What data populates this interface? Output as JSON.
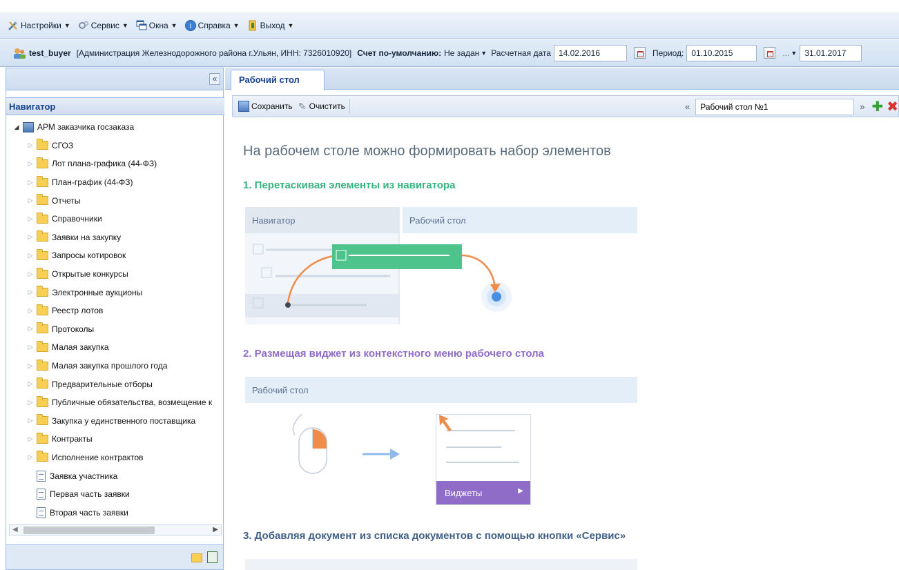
{
  "menu": {
    "items": [
      {
        "label": "Настройки",
        "icon": "settings-icon"
      },
      {
        "label": "Сервис",
        "icon": "service-icon"
      },
      {
        "label": "Окна",
        "icon": "windows-icon"
      },
      {
        "label": "Справка",
        "icon": "help-icon"
      },
      {
        "label": "Выход",
        "icon": "exit-icon"
      }
    ]
  },
  "infobar": {
    "user": "test_buyer",
    "org": "[Администрация Железнодорожного района г.Ульян, ИНН: 7326010920]",
    "account_label": "Счет по-умолчанию:",
    "account_value": "Не задан",
    "calc_date_label": "Расчетная дата",
    "calc_date": "14.02.2016",
    "period_label": "Период:",
    "period_from": "01.10.2015",
    "period_sep": "...",
    "period_to": "31.01.2017"
  },
  "navigator": {
    "collapse_glyph": "«",
    "title": "Навигатор",
    "root": "АРМ заказчика госзаказа",
    "folders": [
      "СГОЗ",
      "Лот плана-графика (44-ФЗ)",
      "План-график (44-ФЗ)",
      "Отчеты",
      "Справочники",
      "Заявки на закупку",
      "Запросы котировок",
      "Открытые конкурсы",
      "Электронные аукционы",
      "Реестр лотов",
      "Протоколы",
      "Малая закупка",
      "Малая закупка прошлого года",
      "Предварительные отборы",
      "Публичные обязательства, возмещение к",
      "Закупка у единственного поставщика",
      "Контракты",
      "Исполнение контрактов"
    ],
    "documents": [
      "Заявка участника",
      "Первая часть заявки",
      "Вторая часть заявки"
    ]
  },
  "tabs": [
    {
      "label": "Рабочий стол"
    }
  ],
  "toolbar": {
    "save_label": "Сохранить",
    "clear_label": "Очистить",
    "prev_glyph": "«",
    "next_glyph": "»",
    "desktop_name": "Рабочий стол №1"
  },
  "content": {
    "title": "На рабочем столе можно формировать набор элементов",
    "step1": "1. Перетаскивая элементы из навигатора",
    "step1_nav_header": "Навигатор",
    "step1_desk_header": "Рабочий стол",
    "step2": "2. Размещая виджет из контекстного меню рабочего стола",
    "step2_header": "Рабочий стол",
    "widgets_label": "Виджеты",
    "step3": "3. Добавляя документ из списка документов с помощью кнопки «Сервис»"
  },
  "colors": {
    "step1": "#36b37e",
    "step2": "#8e6cc8",
    "accent_orange": "#f08c4a",
    "tab_text": "#15428b"
  }
}
